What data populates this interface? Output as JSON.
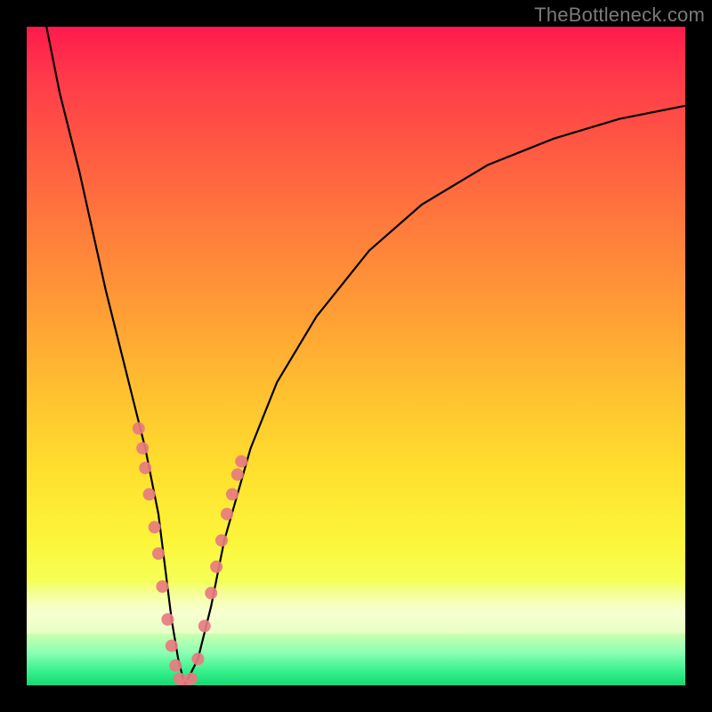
{
  "watermark": "TheBottleneck.com",
  "chart_data": {
    "type": "line",
    "title": "",
    "xlabel": "",
    "ylabel": "",
    "xlim": [
      0,
      100
    ],
    "ylim": [
      0,
      100
    ],
    "grid": false,
    "legend": false,
    "series": [
      {
        "name": "bottleneck-curve",
        "x": [
          3,
          5,
          8,
          10,
          12,
          14,
          16,
          18,
          20,
          21,
          22,
          23,
          24,
          26,
          28,
          30,
          34,
          38,
          44,
          52,
          60,
          70,
          80,
          90,
          100
        ],
        "y": [
          100,
          90,
          78,
          69,
          60,
          52,
          44,
          36,
          26,
          18,
          10,
          4,
          0,
          4,
          12,
          22,
          36,
          46,
          56,
          66,
          73,
          79,
          83,
          86,
          88
        ]
      }
    ],
    "markers": {
      "name": "highlight-dots",
      "color": "#e77b7f",
      "points": [
        {
          "x": 17.0,
          "y": 39
        },
        {
          "x": 17.6,
          "y": 36
        },
        {
          "x": 18.0,
          "y": 33
        },
        {
          "x": 18.6,
          "y": 29
        },
        {
          "x": 19.4,
          "y": 24
        },
        {
          "x": 20.0,
          "y": 20
        },
        {
          "x": 20.6,
          "y": 15
        },
        {
          "x": 21.4,
          "y": 10
        },
        {
          "x": 22.0,
          "y": 6
        },
        {
          "x": 22.6,
          "y": 3
        },
        {
          "x": 23.2,
          "y": 1
        },
        {
          "x": 24.0,
          "y": 0
        },
        {
          "x": 25.0,
          "y": 1
        },
        {
          "x": 26.0,
          "y": 4
        },
        {
          "x": 27.0,
          "y": 9
        },
        {
          "x": 28.0,
          "y": 14
        },
        {
          "x": 28.8,
          "y": 18
        },
        {
          "x": 29.6,
          "y": 22
        },
        {
          "x": 30.4,
          "y": 26
        },
        {
          "x": 31.2,
          "y": 29
        },
        {
          "x": 32.0,
          "y": 32
        },
        {
          "x": 32.6,
          "y": 34
        }
      ]
    }
  }
}
